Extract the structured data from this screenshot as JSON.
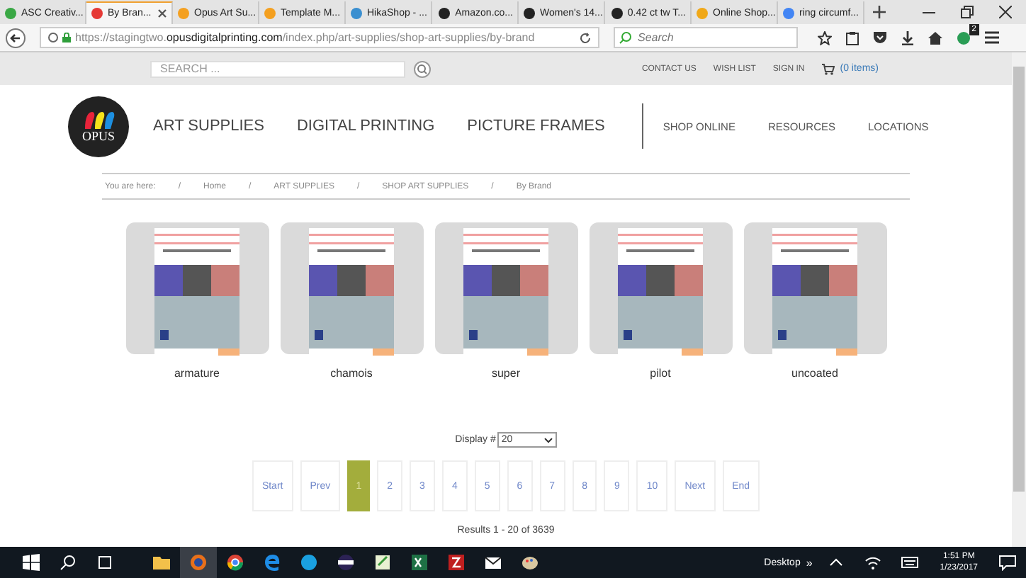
{
  "browser": {
    "tabs": [
      {
        "title": "ASC Creativ...",
        "selected": false,
        "color": "#3aa845"
      },
      {
        "title": "By Bran...",
        "selected": true,
        "color": "#e53935"
      },
      {
        "title": "Opus Art Su...",
        "selected": false,
        "color": "#f4a020"
      },
      {
        "title": "Template M...",
        "selected": false,
        "color": "#f4a020"
      },
      {
        "title": "HikaShop - ...",
        "selected": false,
        "color": "#3a8fd0"
      },
      {
        "title": "Amazon.co...",
        "selected": false,
        "color": "#222222"
      },
      {
        "title": "Women's 14...",
        "selected": false,
        "color": "#222222"
      },
      {
        "title": "0.42 ct tw T...",
        "selected": false,
        "color": "#222222"
      },
      {
        "title": "Online Shop...",
        "selected": false,
        "color": "#f0a818"
      },
      {
        "title": "ring circumf...",
        "selected": false,
        "color": "#4285f4"
      }
    ],
    "url_prefix": "https://stagingtwo.",
    "url_domain": "opusdigitalprinting.com",
    "url_path": "/index.php/art-supplies/shop-art-supplies/by-brand",
    "search_placeholder": "Search",
    "badge": "2"
  },
  "site": {
    "search_placeholder": "SEARCH ...",
    "top_links": [
      "CONTACT US",
      "WISH LIST",
      "SIGN IN"
    ],
    "cart": "(0 items)",
    "logo": "OPUS",
    "main_nav": [
      "ART SUPPLIES",
      "DIGITAL PRINTING",
      "PICTURE FRAMES"
    ],
    "secondary_nav": [
      "SHOP ONLINE",
      "RESOURCES",
      "LOCATIONS"
    ],
    "breadcrumb": {
      "label": "You are here:",
      "items": [
        {
          "separator": "/",
          "label": "Home"
        },
        {
          "separator": "/",
          "label": "ART SUPPLIES"
        },
        {
          "separator": "/",
          "label": "SHOP ART SUPPLIES"
        },
        {
          "separator": "/",
          "label": "By Brand"
        }
      ]
    },
    "products": [
      {
        "name": "armature"
      },
      {
        "name": "chamois"
      },
      {
        "name": "super"
      },
      {
        "name": "pilot"
      },
      {
        "name": "uncoated"
      }
    ],
    "display": {
      "label": "Display #",
      "value": "20"
    },
    "pagination": [
      {
        "label": "Start",
        "selected": false
      },
      {
        "label": "Prev",
        "selected": false
      },
      {
        "label": "1",
        "selected": true
      },
      {
        "label": "2",
        "selected": false
      },
      {
        "label": "3",
        "selected": false
      },
      {
        "label": "4",
        "selected": false
      },
      {
        "label": "5",
        "selected": false
      },
      {
        "label": "6",
        "selected": false
      },
      {
        "label": "7",
        "selected": false
      },
      {
        "label": "8",
        "selected": false
      },
      {
        "label": "9",
        "selected": false
      },
      {
        "label": "10",
        "selected": false
      },
      {
        "label": "Next",
        "selected": false
      },
      {
        "label": "End",
        "selected": false
      }
    ],
    "results": "Results 1 - 20 of 3639"
  },
  "taskbar": {
    "desktop": "Desktop",
    "chevron": "»",
    "time": "1:51 PM",
    "date": "1/23/2017"
  }
}
